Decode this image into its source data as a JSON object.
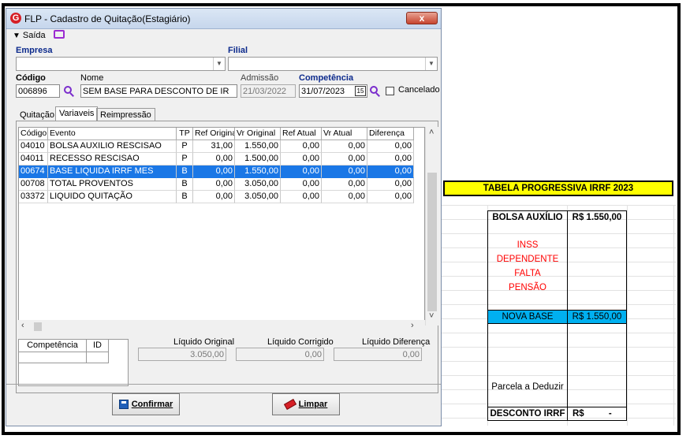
{
  "window": {
    "title": "FLP - Cadastro de Quitação(Estagiário)",
    "close_label": "x"
  },
  "menu": {
    "saida_label": "Saída"
  },
  "form": {
    "empresa_label": "Empresa",
    "filial_label": "Filial",
    "codigo_label": "Código",
    "codigo_value": "006896",
    "nome_label": "Nome",
    "nome_value": "SEM BASE PARA DESCONTO DE IR",
    "admissao_label": "Admissão",
    "admissao_value": "21/03/2022",
    "competencia_label": "Competência",
    "competencia_value": "31/07/2023",
    "cal_label": "15",
    "cancelado_label": "Cancelado"
  },
  "tabs": [
    {
      "label": "Quitação"
    },
    {
      "label": "Variaveis"
    },
    {
      "label": "Reimpressão"
    }
  ],
  "grid": {
    "columns": [
      "Código",
      "Evento",
      "TP",
      "Ref Original",
      "Vr Original",
      "Ref Atual",
      "Vr Atual",
      "Diferença"
    ],
    "rows": [
      [
        "04010",
        "BOLSA AUXILIO RESCISAO",
        "P",
        "31,00",
        "1.550,00",
        "0,00",
        "0,00",
        "0,00"
      ],
      [
        "04011",
        "RECESSO RESCISAO",
        "P",
        "0,00",
        "1.500,00",
        "0,00",
        "0,00",
        "0,00"
      ],
      [
        "00674",
        "BASE LIQUIDA IRRF MES",
        "B",
        "0,00",
        "1.550,00",
        "0,00",
        "0,00",
        "0,00"
      ],
      [
        "00708",
        "TOTAL PROVENTOS",
        "B",
        "0,00",
        "3.050,00",
        "0,00",
        "0,00",
        "0,00"
      ],
      [
        "03372",
        "LIQUIDO QUITAÇÃO",
        "B",
        "0,00",
        "3.050,00",
        "0,00",
        "0,00",
        "0,00"
      ]
    ],
    "selected_row": 2
  },
  "bottom": {
    "mini_cols": [
      "Competência",
      "ID"
    ],
    "liquido_original_label": "Líquido Original",
    "liquido_original_value": "3.050,00",
    "liquido_corrigido_label": "Líquido Corrigido",
    "liquido_corrigido_value": "0,00",
    "liquido_diferenca_label": "Líquido Diferença",
    "liquido_diferenca_value": "0,00"
  },
  "buttons": {
    "confirmar_label": "Confirmar",
    "limpar_label": "Limpar"
  },
  "sheet": {
    "title": "TABELA PROGRESSIVA IRRF 2023",
    "bolsa_label": "BOLSA AUXÍLIO",
    "bolsa_value": "R$ 1.550,00",
    "inss_label": "INSS",
    "dependente_label": "DEPENDENTE",
    "falta_label": "FALTA",
    "pensao_label": "PENSÃO",
    "nova_base_label": "NOVA BASE",
    "nova_base_value": "R$ 1.550,00",
    "parcela_label": "Parcela a Deduzir",
    "desconto_label": "DESCONTO IRRF",
    "desconto_currency": "R$",
    "desconto_value": "-"
  }
}
